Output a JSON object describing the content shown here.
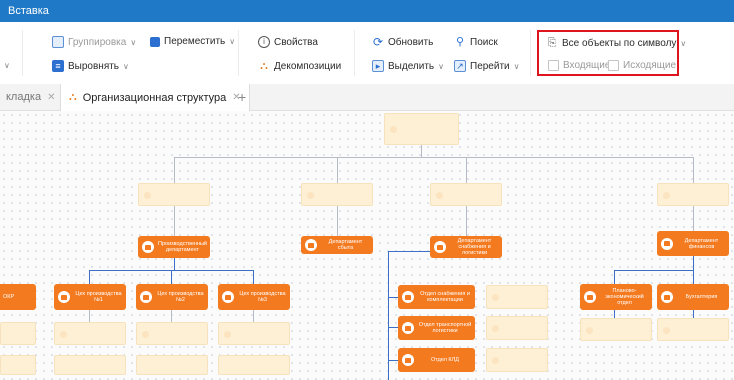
{
  "window": {
    "title": "Вставка"
  },
  "ribbon": {
    "grouping": "Группировка",
    "align": "Выровнять",
    "move": "Переместить",
    "properties": "Свойства",
    "decompositions": "Декомпозиции",
    "refresh": "Обновить",
    "select": "Выделить",
    "search": "Поиск",
    "goto": "Перейти",
    "symbol_objects": "Все объекты по символу",
    "incoming": "Входящие",
    "outgoing": "Исходящие"
  },
  "tabs": [
    {
      "label": "кладка"
    },
    {
      "label": "Организационная структура"
    }
  ],
  "nodes": {
    "prod_dept": "Производственный департамент",
    "dept_sales": "Департамент сбыта",
    "dept_supply": "Департамент снабжения и логистики",
    "dept_finance": "Департамент финансов",
    "okr": "ОКР",
    "shop1": "Цех производства №1",
    "shop2": "Цех производства №2",
    "shop3": "Цех производства №3",
    "supply_sub": "Отдел снабжения и комплектации",
    "transport": "Отдел транспортной логистики",
    "warehouse": "Отдел КЛД",
    "plan_econ": "Планово-экономический отдел",
    "accounting": "Бухгалтерия"
  },
  "colors": {
    "titlebar": "#1f79c6",
    "node": "#f47a20",
    "ghost": "#fdf0d5",
    "highlight": "#e0141e",
    "link": "#3d6fc7"
  }
}
